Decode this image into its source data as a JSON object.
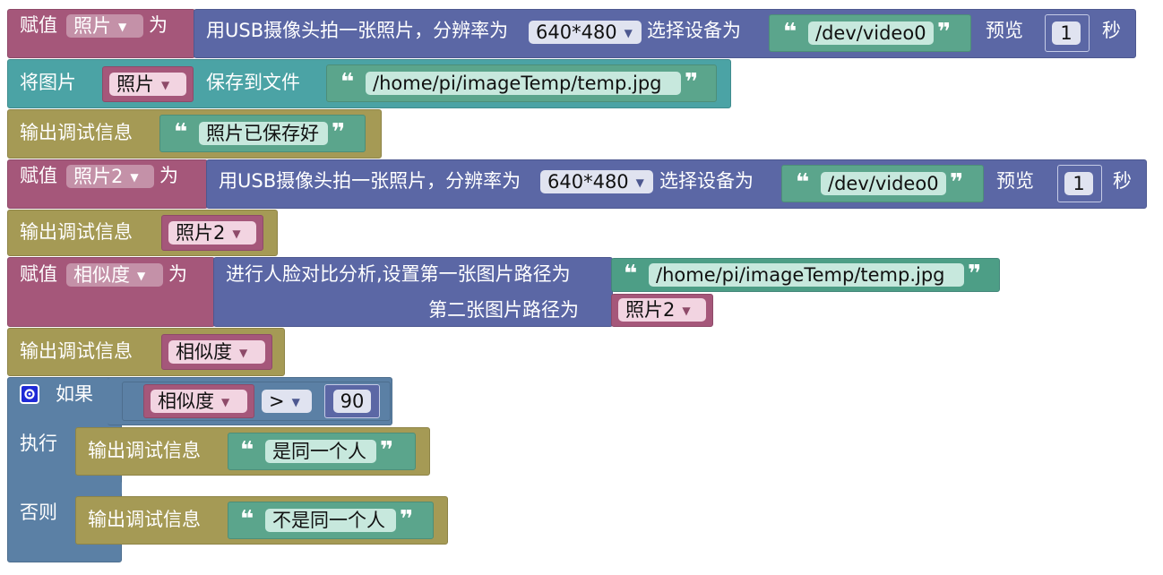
{
  "rows": {
    "r1": {
      "assign": "赋值",
      "var": "照片",
      "as": "为",
      "cam_text": "用USB摄像头拍一张照片，分辨率为",
      "resolution": "640*480",
      "select_device": "选择设备为",
      "device": "/dev/video0",
      "preview": "预览",
      "preview_value": "1",
      "seconds": "秒"
    },
    "r2": {
      "save_image": "将图片",
      "var": "照片",
      "save_to": "保存到文件",
      "path": "/home/pi/imageTemp/temp.jpg"
    },
    "r3": {
      "debug": "输出调试信息",
      "text": "照片已保存好"
    },
    "r4": {
      "assign": "赋值",
      "var": "照片2",
      "as": "为",
      "cam_text": "用USB摄像头拍一张照片，分辨率为",
      "resolution": "640*480",
      "select_device": "选择设备为",
      "device": "/dev/video0",
      "preview": "预览",
      "preview_value": "1",
      "seconds": "秒"
    },
    "r5": {
      "debug": "输出调试信息",
      "var": "照片2"
    },
    "r6": {
      "assign": "赋值",
      "var": "相似度",
      "as": "为",
      "face_text": "进行人脸对比分析,设置第一张图片路径为",
      "path1": "/home/pi/imageTemp/temp.jpg",
      "second_text": "第二张图片路径为",
      "var2": "照片2"
    },
    "r7": {
      "debug": "输出调试信息",
      "var": "相似度"
    },
    "r8": {
      "if": "如果",
      "var": "相似度",
      "op": ">",
      "value": "90",
      "do": "执行",
      "else": "否则",
      "debug_do": "输出调试信息",
      "text_do": "是同一个人",
      "debug_else": "输出调试信息",
      "text_else": "不是同一个人"
    }
  },
  "icons": {
    "dropdown": "▼",
    "open_quote": "❝",
    "close_quote": "❞",
    "mutator": "gear-icon"
  },
  "colors": {
    "variable": "#a5577a",
    "camera": "#5b67a5",
    "file": "#4ba3a5",
    "debug": "#a59a55",
    "text": "#5ba58c",
    "logic": "#5b80a5",
    "mutator": "#1f2ad6"
  }
}
